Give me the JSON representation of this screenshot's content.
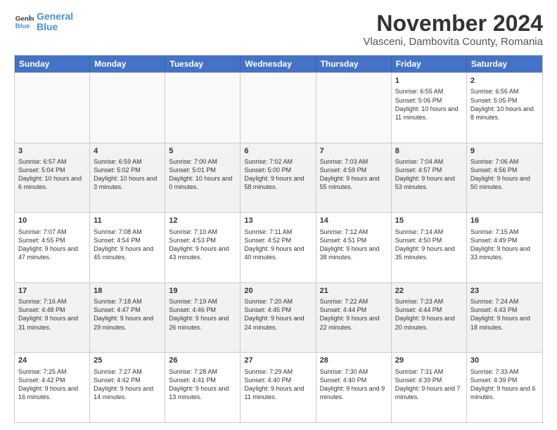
{
  "header": {
    "logo_line1": "General",
    "logo_line2": "Blue",
    "month_title": "November 2024",
    "location": "Vlasceni, Dambovita County, Romania"
  },
  "days_of_week": [
    "Sunday",
    "Monday",
    "Tuesday",
    "Wednesday",
    "Thursday",
    "Friday",
    "Saturday"
  ],
  "rows": [
    [
      {
        "day": "",
        "info": ""
      },
      {
        "day": "",
        "info": ""
      },
      {
        "day": "",
        "info": ""
      },
      {
        "day": "",
        "info": ""
      },
      {
        "day": "",
        "info": ""
      },
      {
        "day": "1",
        "info": "Sunrise: 6:55 AM\nSunset: 5:06 PM\nDaylight: 10 hours and 11 minutes."
      },
      {
        "day": "2",
        "info": "Sunrise: 6:56 AM\nSunset: 5:05 PM\nDaylight: 10 hours and 8 minutes."
      }
    ],
    [
      {
        "day": "3",
        "info": "Sunrise: 6:57 AM\nSunset: 5:04 PM\nDaylight: 10 hours and 6 minutes."
      },
      {
        "day": "4",
        "info": "Sunrise: 6:59 AM\nSunset: 5:02 PM\nDaylight: 10 hours and 3 minutes."
      },
      {
        "day": "5",
        "info": "Sunrise: 7:00 AM\nSunset: 5:01 PM\nDaylight: 10 hours and 0 minutes."
      },
      {
        "day": "6",
        "info": "Sunrise: 7:02 AM\nSunset: 5:00 PM\nDaylight: 9 hours and 58 minutes."
      },
      {
        "day": "7",
        "info": "Sunrise: 7:03 AM\nSunset: 4:59 PM\nDaylight: 9 hours and 55 minutes."
      },
      {
        "day": "8",
        "info": "Sunrise: 7:04 AM\nSunset: 4:57 PM\nDaylight: 9 hours and 53 minutes."
      },
      {
        "day": "9",
        "info": "Sunrise: 7:06 AM\nSunset: 4:56 PM\nDaylight: 9 hours and 50 minutes."
      }
    ],
    [
      {
        "day": "10",
        "info": "Sunrise: 7:07 AM\nSunset: 4:55 PM\nDaylight: 9 hours and 47 minutes."
      },
      {
        "day": "11",
        "info": "Sunrise: 7:08 AM\nSunset: 4:54 PM\nDaylight: 9 hours and 45 minutes."
      },
      {
        "day": "12",
        "info": "Sunrise: 7:10 AM\nSunset: 4:53 PM\nDaylight: 9 hours and 43 minutes."
      },
      {
        "day": "13",
        "info": "Sunrise: 7:11 AM\nSunset: 4:52 PM\nDaylight: 9 hours and 40 minutes."
      },
      {
        "day": "14",
        "info": "Sunrise: 7:12 AM\nSunset: 4:51 PM\nDaylight: 9 hours and 38 minutes."
      },
      {
        "day": "15",
        "info": "Sunrise: 7:14 AM\nSunset: 4:50 PM\nDaylight: 9 hours and 35 minutes."
      },
      {
        "day": "16",
        "info": "Sunrise: 7:15 AM\nSunset: 4:49 PM\nDaylight: 9 hours and 33 minutes."
      }
    ],
    [
      {
        "day": "17",
        "info": "Sunrise: 7:16 AM\nSunset: 4:48 PM\nDaylight: 9 hours and 31 minutes."
      },
      {
        "day": "18",
        "info": "Sunrise: 7:18 AM\nSunset: 4:47 PM\nDaylight: 9 hours and 29 minutes."
      },
      {
        "day": "19",
        "info": "Sunrise: 7:19 AM\nSunset: 4:46 PM\nDaylight: 9 hours and 26 minutes."
      },
      {
        "day": "20",
        "info": "Sunrise: 7:20 AM\nSunset: 4:45 PM\nDaylight: 9 hours and 24 minutes."
      },
      {
        "day": "21",
        "info": "Sunrise: 7:22 AM\nSunset: 4:44 PM\nDaylight: 9 hours and 22 minutes."
      },
      {
        "day": "22",
        "info": "Sunrise: 7:23 AM\nSunset: 4:44 PM\nDaylight: 9 hours and 20 minutes."
      },
      {
        "day": "23",
        "info": "Sunrise: 7:24 AM\nSunset: 4:43 PM\nDaylight: 9 hours and 18 minutes."
      }
    ],
    [
      {
        "day": "24",
        "info": "Sunrise: 7:25 AM\nSunset: 4:42 PM\nDaylight: 9 hours and 16 minutes."
      },
      {
        "day": "25",
        "info": "Sunrise: 7:27 AM\nSunset: 4:42 PM\nDaylight: 9 hours and 14 minutes."
      },
      {
        "day": "26",
        "info": "Sunrise: 7:28 AM\nSunset: 4:41 PM\nDaylight: 9 hours and 13 minutes."
      },
      {
        "day": "27",
        "info": "Sunrise: 7:29 AM\nSunset: 4:40 PM\nDaylight: 9 hours and 11 minutes."
      },
      {
        "day": "28",
        "info": "Sunrise: 7:30 AM\nSunset: 4:40 PM\nDaylight: 9 hours and 9 minutes."
      },
      {
        "day": "29",
        "info": "Sunrise: 7:31 AM\nSunset: 4:39 PM\nDaylight: 9 hours and 7 minutes."
      },
      {
        "day": "30",
        "info": "Sunrise: 7:33 AM\nSunset: 4:39 PM\nDaylight: 9 hours and 6 minutes."
      }
    ]
  ]
}
